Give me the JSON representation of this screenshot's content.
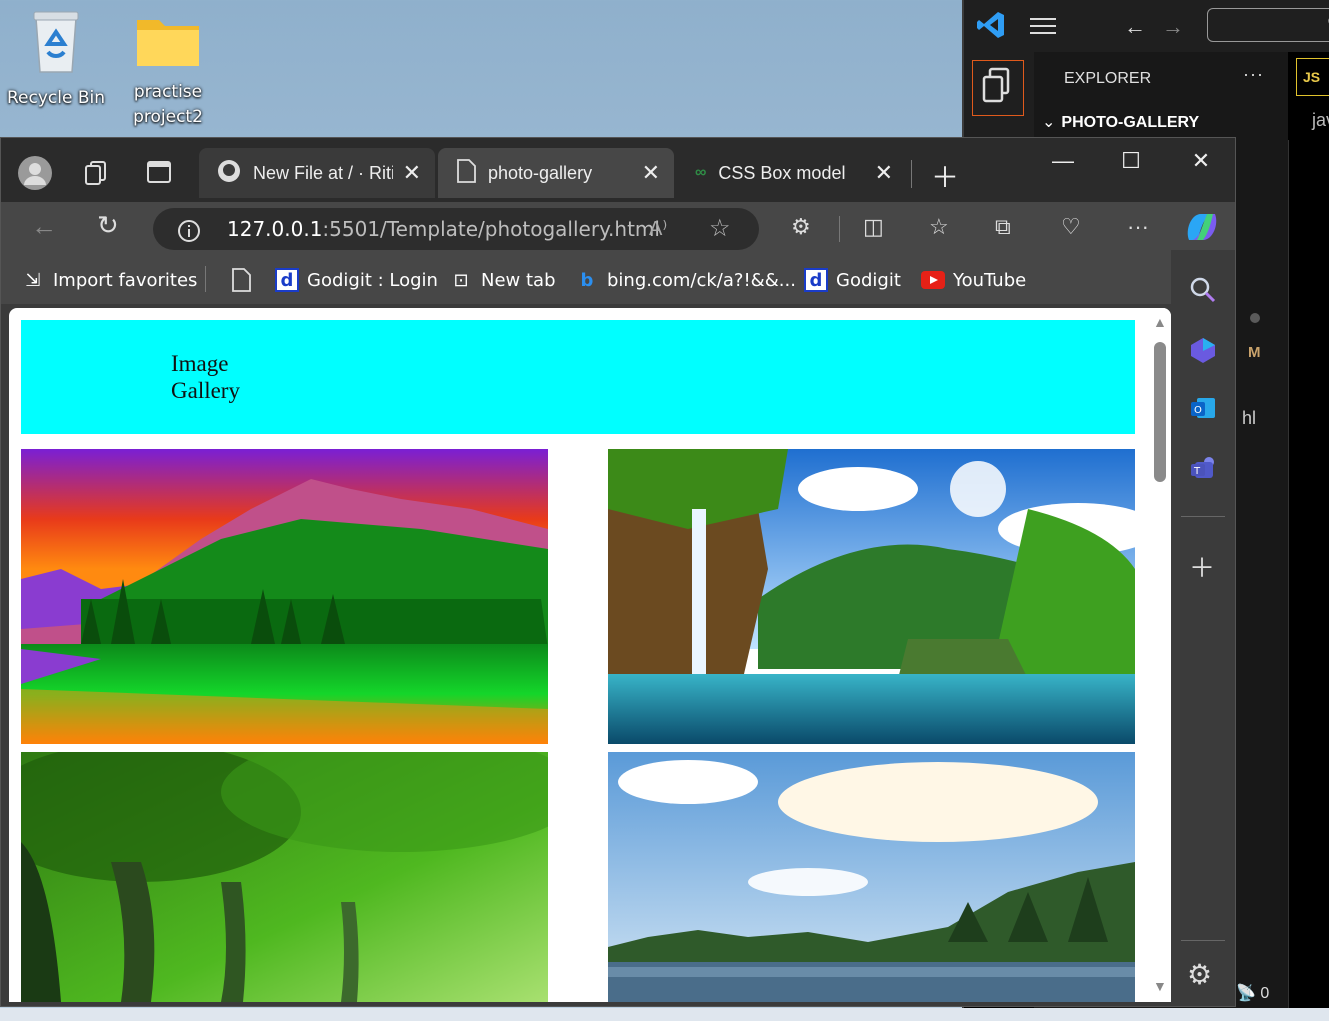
{
  "desktop": {
    "icons": [
      {
        "label": "Recycle Bin",
        "icon": "recycle-bin-icon"
      },
      {
        "label": "practise project2",
        "icon": "folder-icon"
      }
    ]
  },
  "vscode": {
    "explorer_title": "EXPLORER",
    "explorer_more": "···",
    "folder_name": "PHOTO-GALLERY",
    "editor_tab_lang": "JS",
    "editor_fragment": "jav",
    "scm_badge": "M",
    "html_fragment": "hl",
    "status_ports": "0"
  },
  "browser": {
    "tabs": [
      {
        "label": "New File at / · Ritika",
        "icon": "github-icon",
        "active": false
      },
      {
        "label": "photo-gallery",
        "icon": "page-icon",
        "active": true
      },
      {
        "label": "CSS Box model - GeeksforGeeks",
        "icon": "gfg-icon",
        "active": false
      }
    ],
    "url_host": "127.0.0.1",
    "url_path": ":5501/Template/photogallery.html",
    "bookmarks": [
      {
        "label": "Import favorites",
        "icon": "import-icon"
      },
      {
        "label": "",
        "icon": "page-icon"
      },
      {
        "label": "Godigit : Login",
        "icon": "godigit-icon"
      },
      {
        "label": "New tab",
        "icon": "newtab-icon"
      },
      {
        "label": "bing.com/ck/a?!&&...",
        "icon": "bing-icon"
      },
      {
        "label": "Godigit",
        "icon": "godigit-icon"
      },
      {
        "label": "YouTube",
        "icon": "youtube-icon"
      }
    ]
  },
  "page": {
    "header_title": "Image Gallery",
    "header_color": "#00ffff",
    "photos": [
      {
        "name": "sunset-mountain-lake"
      },
      {
        "name": "waterfall-lagoon"
      },
      {
        "name": "green-forest"
      },
      {
        "name": "lake-cloudy-sky"
      }
    ]
  }
}
